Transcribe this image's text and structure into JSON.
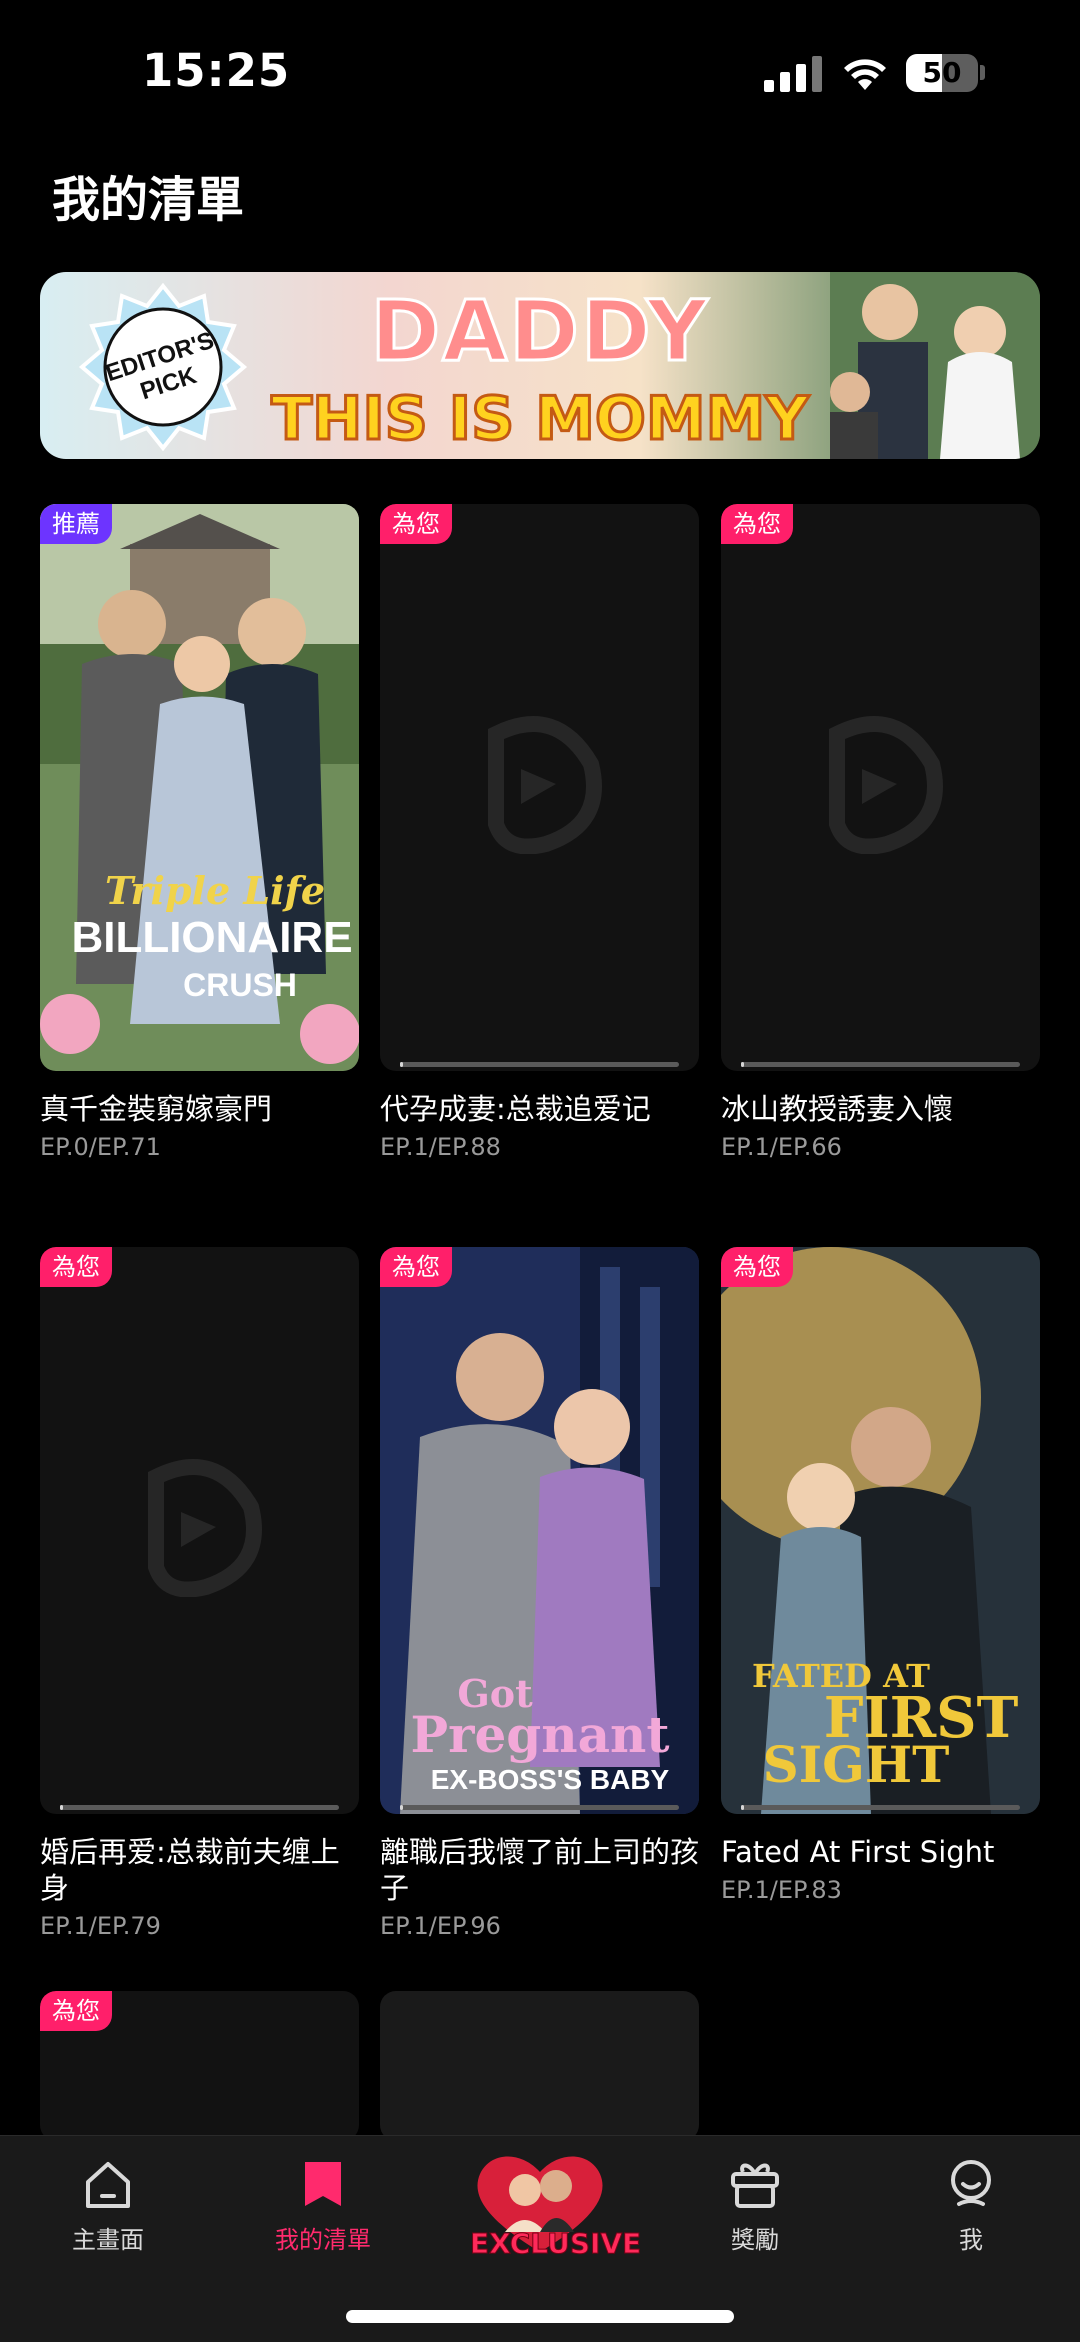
{
  "status_bar": {
    "time": "15:25",
    "battery_level": "50",
    "battery_fraction": 0.5
  },
  "page": {
    "title": "我的清單"
  },
  "banner": {
    "badge_line1": "EDITOR'S",
    "badge_line2": "PICK",
    "title_line1": "DADDY",
    "title_line2": "THIS IS MOMMY"
  },
  "cards": [
    {
      "tag": "推薦",
      "title": "真千金裝窮嫁豪門",
      "episodes": "EP.0/EP.71",
      "poster_line1": "Triple Life",
      "poster_line2": "BILLIONAIRE",
      "poster_line3": "CRUSH",
      "progress": 0
    },
    {
      "tag": "為您",
      "title": "代孕成妻:总裁追爱记",
      "episodes": "EP.1/EP.88",
      "progress": 0.01
    },
    {
      "tag": "為您",
      "title": "冰山教授誘妻入懷",
      "episodes": "EP.1/EP.66",
      "progress": 0.01
    },
    {
      "tag": "為您",
      "title": "婚后再爱:总裁前夫缠上身",
      "episodes": "EP.1/EP.79",
      "progress": 0.01
    },
    {
      "tag": "為您",
      "title": "離職后我懷了前上司的孩子",
      "episodes": "EP.1/EP.96",
      "poster_line1": "Got",
      "poster_line2": "Pregnant",
      "poster_line3": "EX-BOSS'S BABY",
      "progress": 0.01
    },
    {
      "tag": "為您",
      "title": "Fated At First Sight",
      "episodes": "EP.1/EP.83",
      "poster_line1": "FATED AT",
      "poster_line2": "FIRST",
      "poster_line3": "SIGHT",
      "progress": 0.01
    },
    {
      "tag": "為您"
    }
  ],
  "tabbar": {
    "home": "主畫面",
    "mylist": "我的清單",
    "exclusive": "EXCLUSIVE",
    "rewards": "獎勵",
    "me": "我"
  }
}
